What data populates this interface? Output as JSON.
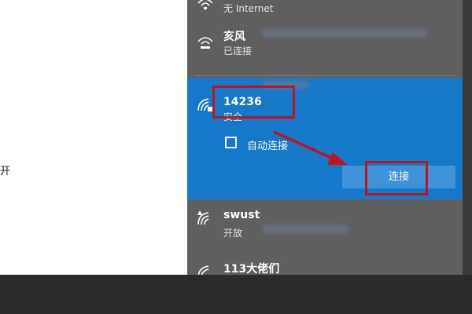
{
  "left_pane": {
    "text": "开"
  },
  "networks": [
    {
      "name": "",
      "status": "无 Internet"
    },
    {
      "name": "亥风",
      "status": "已连接"
    },
    {
      "name": "14236",
      "status": "安全",
      "selected": true
    },
    {
      "name": "swust",
      "status": "开放"
    },
    {
      "name": "113大佬们",
      "status": ""
    }
  ],
  "selected": {
    "auto_connect_label": "自动连接",
    "auto_connect_checked": false,
    "connect_label": "连接"
  },
  "icons": {
    "wifi": "wifi-icon",
    "wifi_secure": "wifi-secure-icon",
    "wifi_open": "wifi-warning-icon",
    "checkbox": "checkbox-icon",
    "arrow": "arrow-annotation-icon"
  },
  "colors": {
    "panel_bg": "#5f5f5f",
    "selected_bg": "#1578c8",
    "button_bg": "#3f93d8",
    "highlight": "#c2141c",
    "bottom_bar": "#2b2b2b"
  }
}
